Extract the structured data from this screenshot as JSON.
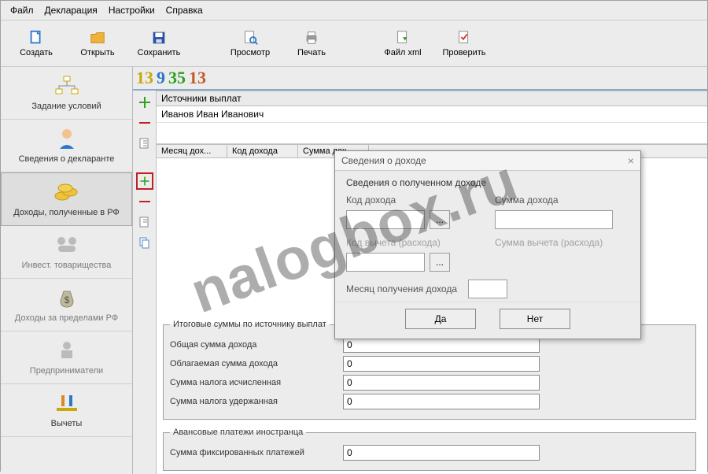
{
  "menu": {
    "items": [
      "Файл",
      "Декларация",
      "Настройки",
      "Справка"
    ]
  },
  "toolbar": {
    "create": "Создать",
    "open": "Открыть",
    "save": "Сохранить",
    "preview": "Просмотр",
    "print": "Печать",
    "file_xml": "Файл xml",
    "check": "Проверить"
  },
  "big_digits": [
    {
      "text": "13",
      "color": "#c8a80a"
    },
    {
      "text": "9",
      "color": "#2a78c9"
    },
    {
      "text": "35",
      "color": "#2da01e"
    },
    {
      "text": "13",
      "color": "#c45a26"
    }
  ],
  "sidebar": {
    "items": [
      {
        "label": "Задание условий"
      },
      {
        "label": "Сведения о декларанте"
      },
      {
        "label": "Доходы, полученные в РФ"
      },
      {
        "label": "Инвест. товарищества"
      },
      {
        "label": "Доходы за пределами РФ"
      },
      {
        "label": "Предприниматели"
      },
      {
        "label": "Вычеты"
      }
    ]
  },
  "sources": {
    "header": "Источники выплат",
    "row1": "Иванов Иван Иванович"
  },
  "income_table": {
    "cols": [
      "Месяц дох...",
      "Код дохода",
      "Сумма дох..."
    ]
  },
  "totals": {
    "legend": "Итоговые суммы по источнику выплат",
    "rows": [
      {
        "label": "Общая сумма дохода",
        "value": "0"
      },
      {
        "label": "Облагаемая сумма дохода",
        "value": "0"
      },
      {
        "label": "Сумма налога исчисленная",
        "value": "0"
      },
      {
        "label": "Сумма налога удержанная",
        "value": "0"
      }
    ]
  },
  "advance": {
    "legend": "Авансовые платежи иностранца",
    "label": "Сумма фиксированных платежей",
    "value": "0"
  },
  "dialog": {
    "title": "Сведения о доходе",
    "group": "Сведения о полученном доходе",
    "income_code": "Код дохода",
    "income_sum": "Сумма дохода",
    "deduct_code": "Код вычета (расхода)",
    "deduct_sum": "Сумма вычета (расхода)",
    "month": "Месяц получения дохода",
    "picker": "...",
    "yes": "Да",
    "no": "Нет"
  },
  "watermark": "nalogbox.ru"
}
